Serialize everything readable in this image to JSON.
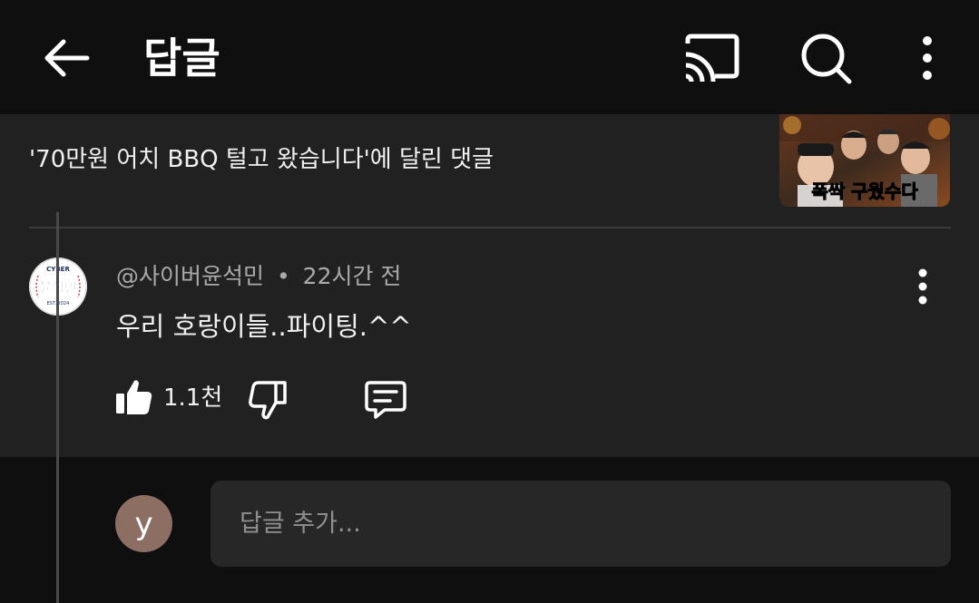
{
  "header": {
    "title": "답글",
    "back_icon": "arrow-left-icon",
    "cast_icon": "cast-icon",
    "search_icon": "search-icon",
    "more_icon": "more-vertical-icon"
  },
  "context": {
    "text": "'70만원 어치 BBQ 털고 왔습니다'에 달린 댓글",
    "thumbnail_caption": "폭싹 구웠수다"
  },
  "comment": {
    "author": "@사이버윤석민",
    "separator": "•",
    "time": "22시간 전",
    "text": "우리 호랑이들..파이팅.^^",
    "like_count": "1.1천",
    "avatar_badge": {
      "top_text": "CYBER",
      "main_text": "윤석민",
      "bottom_text": "EST. 2024"
    }
  },
  "reply_box": {
    "avatar_letter": "y",
    "placeholder": "답글 추가..."
  },
  "colors": {
    "background": "#0f0f0f",
    "panel": "#212121",
    "input_bg": "#272727",
    "avatar_bg": "#8d6e63"
  }
}
